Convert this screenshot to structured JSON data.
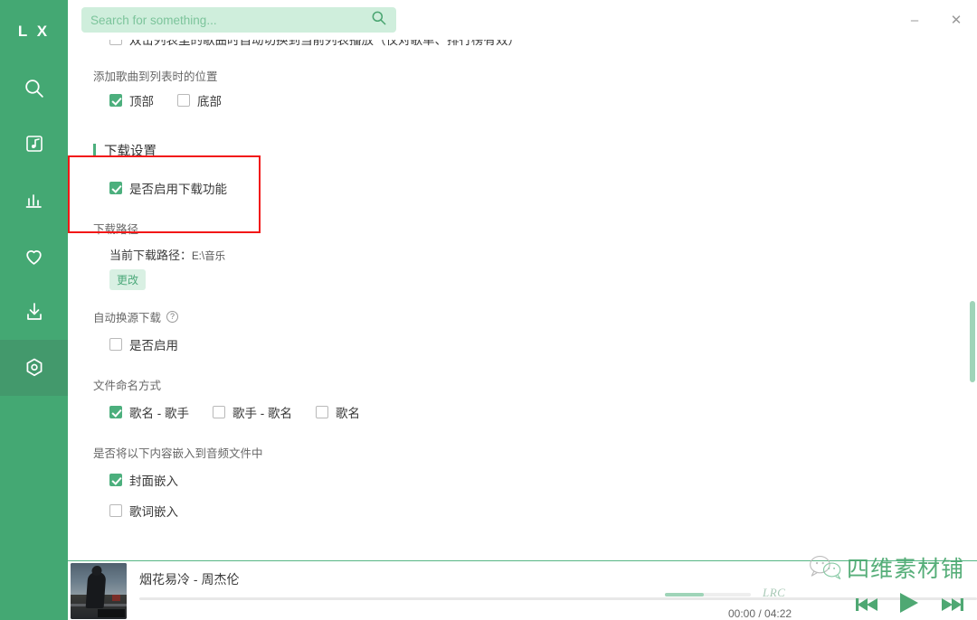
{
  "window": {
    "minimize_label": "–",
    "close_label": "✕"
  },
  "sidebar": {
    "logo": "L X",
    "items": [
      {
        "icon": "search-icon",
        "name": "search"
      },
      {
        "icon": "music-library-icon",
        "name": "songlist"
      },
      {
        "icon": "chart-bar-icon",
        "name": "leaderboard"
      },
      {
        "icon": "heart-icon",
        "name": "favorites"
      },
      {
        "icon": "download-icon",
        "name": "download"
      },
      {
        "icon": "settings-gear-icon",
        "name": "settings",
        "active": true
      }
    ]
  },
  "search": {
    "placeholder": "Search for something...",
    "value": "",
    "icon": "search-icon"
  },
  "settings": {
    "clipped_option": {
      "label": "双击列表里的歌曲时自动切换到当前列表播放（仅对歌单、排行榜有效）",
      "checked": false
    },
    "add_position": {
      "title": "添加歌曲到列表时的位置",
      "options": [
        {
          "label": "顶部",
          "checked": true
        },
        {
          "label": "底部",
          "checked": false
        }
      ]
    },
    "download_section": {
      "heading": "下载设置",
      "enable": {
        "label": "是否启用下载功能",
        "checked": true
      },
      "path_title": "下载路径",
      "path_label": "当前下载路径：",
      "path_value": "E:\\音乐",
      "change_button": "更改"
    },
    "auto_switch": {
      "title": "自动换源下载",
      "help_glyph": "?",
      "enable": {
        "label": "是否启用",
        "checked": false
      }
    },
    "file_naming": {
      "title": "文件命名方式",
      "options": [
        {
          "label": "歌名 - 歌手",
          "checked": true
        },
        {
          "label": "歌手 - 歌名",
          "checked": false
        },
        {
          "label": "歌名",
          "checked": false
        }
      ]
    },
    "embed": {
      "title": "是否将以下内容嵌入到音频文件中",
      "options": [
        {
          "label": "封面嵌入",
          "checked": true
        },
        {
          "label": "歌词嵌入",
          "checked": false
        }
      ]
    }
  },
  "player": {
    "song": "烟花易冷 - 周杰伦",
    "current_time": "00:00",
    "total_time": "04:22",
    "timecode": "00:00 / 04:22",
    "progress_percent": 0,
    "volume_percent": 45,
    "lrc_label": "LRC",
    "prev_icon": "previous-track-icon",
    "play_icon": "play-icon",
    "next_icon": "next-track-icon",
    "album_art_alt": "album-cover"
  },
  "watermark": {
    "text": "四维素材铺",
    "icon": "wechat-icon"
  },
  "colors": {
    "brand_green": "#44a873",
    "accent_green": "#4caf7d",
    "sidebar_active": "#43996c",
    "search_bg": "#cfeedc",
    "annotation_red": "#f21717",
    "scrollbar": "#9fd4b8"
  }
}
